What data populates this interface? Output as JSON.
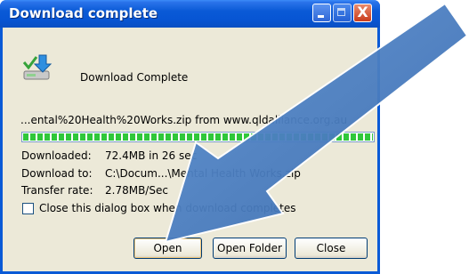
{
  "window": {
    "title": "Download complete",
    "title_buttons": {
      "close_glyph": "X"
    }
  },
  "header": {
    "icon": "download-complete-icon",
    "text": "Download Complete"
  },
  "download": {
    "filename_line": "...ental%20Health%20Works.zip from www.qldalliance.org.au",
    "progress_percent": 100,
    "rows": [
      {
        "label": "Downloaded:",
        "value": "72.4MB in 26 sec"
      },
      {
        "label": "Download to:",
        "value": "C:\\Docum...\\Mental Health Works.zip"
      },
      {
        "label": "Transfer rate:",
        "value": "2.78MB/Sec"
      }
    ]
  },
  "options": {
    "close_dialog_label": "Close this dialog box when download completes",
    "close_dialog_checked": false
  },
  "buttons": {
    "open": "Open",
    "open_folder": "Open Folder",
    "close": "Close"
  },
  "overlay": {
    "arrow_color": "#3b6db0",
    "arrow_icon": "pointer-arrow-icon"
  }
}
